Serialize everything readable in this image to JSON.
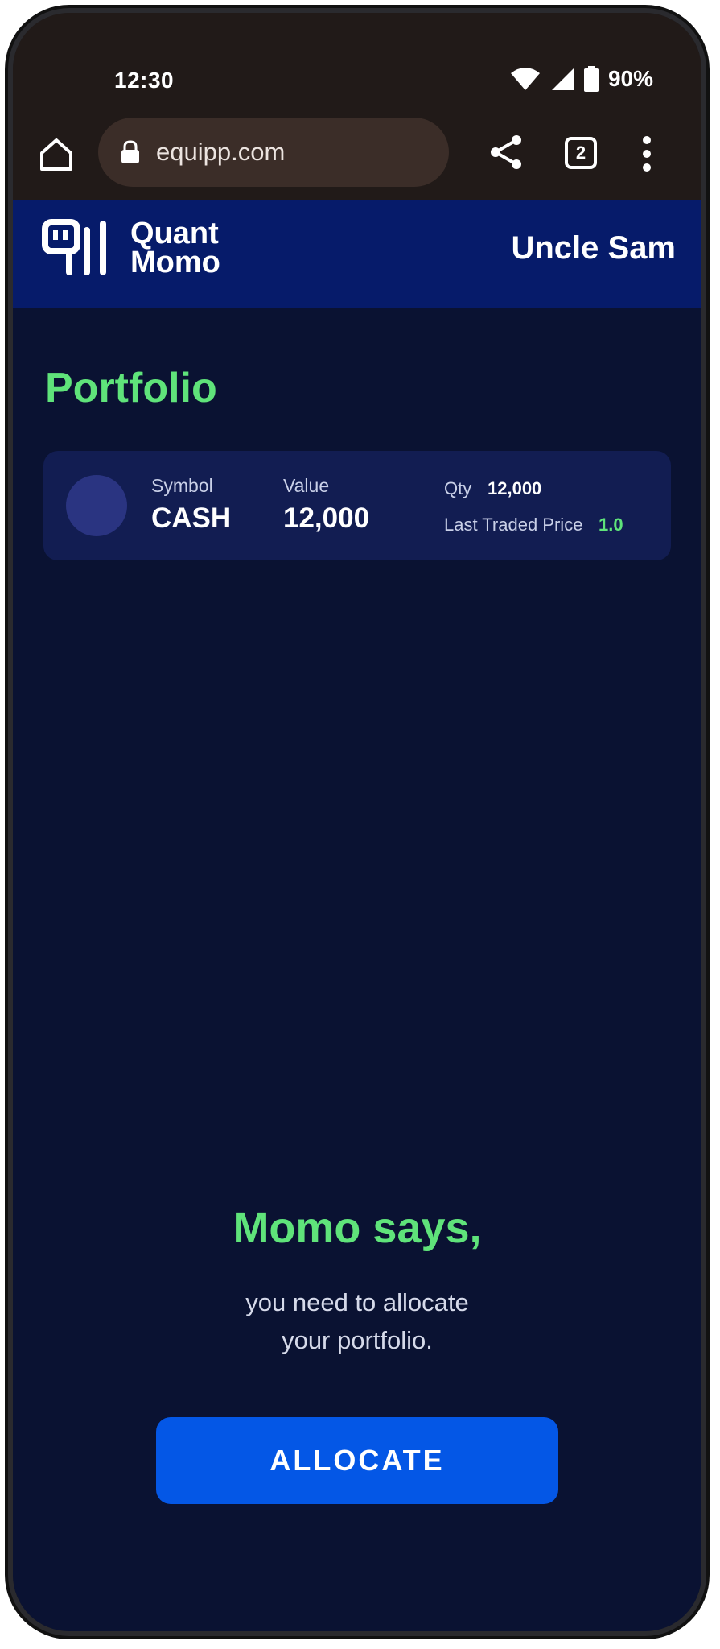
{
  "status_bar": {
    "time": "12:30",
    "battery": "90%"
  },
  "browser": {
    "url": "equipp.com",
    "tab_count": "2"
  },
  "header": {
    "logo_line1": "Quant",
    "logo_line2": "Momo",
    "user_name": "Uncle Sam"
  },
  "portfolio": {
    "title": "Portfolio",
    "holdings": [
      {
        "symbol_label": "Symbol",
        "symbol": "CASH",
        "value_label": "Value",
        "value": "12,000",
        "qty_label": "Qty",
        "qty": "12,000",
        "ltp_label": "Last Traded Price",
        "ltp": "1.0"
      }
    ]
  },
  "momo": {
    "title": "Momo says,",
    "message_line1": "you need to allocate",
    "message_line2": "your portfolio.",
    "button_label": "ALLOCATE"
  },
  "colors": {
    "accent_green": "#5fe37a",
    "button_blue": "#0457e6",
    "header_blue": "#061b6a",
    "background": "#0a1232"
  }
}
